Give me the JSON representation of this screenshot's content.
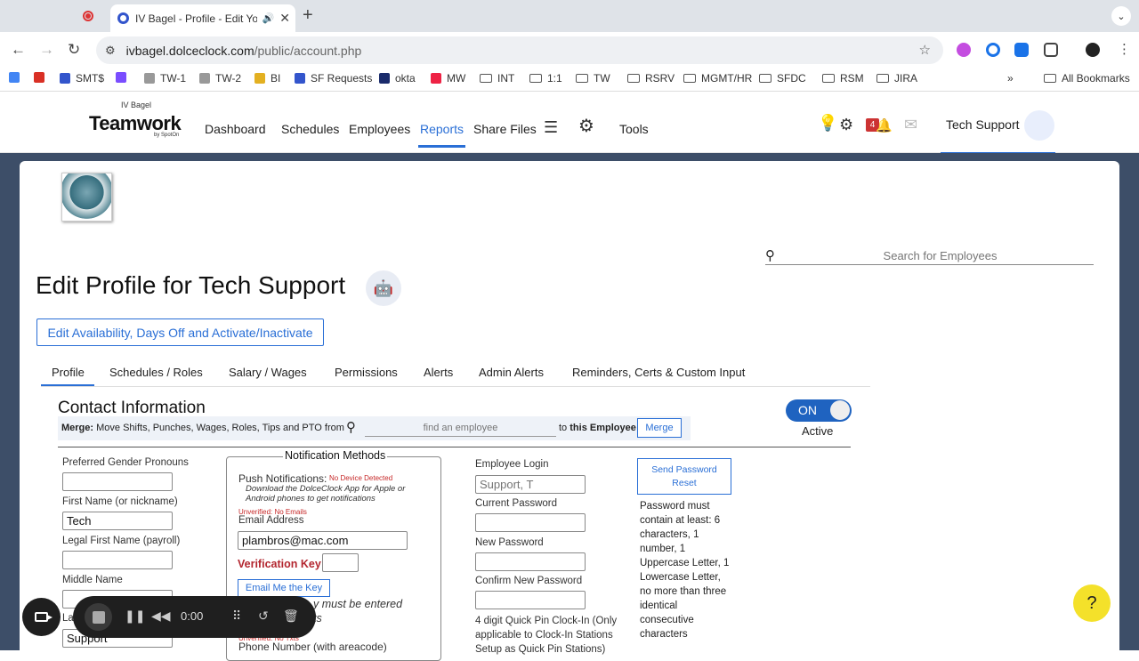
{
  "browser": {
    "tab_title": "IV Bagel - Profile - Edit Yo",
    "new_tab": "+",
    "tab_menu": "⌄",
    "url_host": "ivbagel.dolceclock.com",
    "url_path": "/public/account.php"
  },
  "bookmarks": [
    {
      "label": "",
      "icon": "calendar-icon",
      "color": "#4285f4"
    },
    {
      "label": "",
      "icon": "gmail-icon",
      "color": "#d93025"
    },
    {
      "label": "SMT$",
      "icon": "o-icon",
      "color": "#3355cc"
    },
    {
      "label": "",
      "icon": "s-icon",
      "color": "#7a4dff"
    },
    {
      "label": "TW-1",
      "icon": "mail-icon",
      "color": "#999"
    },
    {
      "label": "TW-2",
      "icon": "mail-icon",
      "color": "#999"
    },
    {
      "label": "BI",
      "icon": "chart-icon",
      "color": "#e3b021"
    },
    {
      "label": "SF Requests",
      "icon": "o-icon",
      "color": "#3355cc"
    },
    {
      "label": "okta",
      "icon": "okta-icon",
      "color": "#1a2b6b"
    },
    {
      "label": "MW",
      "icon": "mw-icon",
      "color": "#e24"
    },
    {
      "label": "INT",
      "icon": "folder-icon"
    },
    {
      "label": "1:1",
      "icon": "folder-icon"
    },
    {
      "label": "TW",
      "icon": "folder-icon"
    },
    {
      "label": "RSRV",
      "icon": "folder-icon"
    },
    {
      "label": "MGMT/HR",
      "icon": "folder-icon"
    },
    {
      "label": "SFDC",
      "icon": "folder-icon"
    },
    {
      "label": "RSM",
      "icon": "folder-icon"
    },
    {
      "label": "JIRA",
      "icon": "folder-icon"
    }
  ],
  "all_bookmarks": "All Bookmarks",
  "more_bookmarks": "»",
  "app": {
    "business": "IV Bagel",
    "logo": "Teamwork",
    "logo_sub": "by SpotOn",
    "nav": [
      "Dashboard",
      "Schedules",
      "Employees",
      "Reports",
      "Share Files",
      "Tools"
    ],
    "notif_count": "4",
    "user": "Tech Support"
  },
  "search": {
    "placeholder": "Search for Employees"
  },
  "page": {
    "title": "Edit Profile for Tech Support",
    "avail_button": "Edit Availability, Days Off and Activate/Inactivate",
    "tabs": [
      "Profile",
      "Schedules / Roles",
      "Salary / Wages",
      "Permissions",
      "Alerts",
      "Admin Alerts",
      "Reminders, Certs & Custom Input"
    ],
    "active_tab": "Profile"
  },
  "contact": {
    "heading": "Contact Information",
    "merge_label": "Merge:",
    "merge_text": "Move Shifts, Punches, Wages, Roles, Tips and PTO from",
    "merge_placeholder": "find an employee",
    "merge_to": "to",
    "merge_target": "this Employee",
    "merge_button": "Merge",
    "toggle": "ON",
    "status": "Active"
  },
  "fields": {
    "pronouns_label": "Preferred Gender Pronouns",
    "pronouns_value": "",
    "first_label": "First Name (or nickname)",
    "first_value": "Tech",
    "legal_first_label": "Legal First Name (payroll)",
    "legal_first_value": "",
    "middle_label": "Middle Name",
    "middle_value": "",
    "last_label": "La",
    "last_value": "Support"
  },
  "notif": {
    "title": "Notification Methods",
    "push_label": "Push Notifications:",
    "push_status": "No Device Detected",
    "push_hint": "Download the DolceClock App for Apple or Android phones to get notifications",
    "email_unverified": "Unverified: No Emails",
    "email_label": "Email Address",
    "email_value": "plambros@mac.com",
    "vkey_label": "Verification Key",
    "vkey_value": "",
    "email_key_button": "Email Me the Key",
    "hidden_note1": "y must be entered",
    "hidden_note2": "ts",
    "phone_unverified": "Unverified: No Txts",
    "phone_label": "Phone Number (with areacode)"
  },
  "login": {
    "login_label": "Employee Login",
    "login_placeholder": "Support, T",
    "current_label": "Current Password",
    "new_label": "New Password",
    "confirm_label": "Confirm New Password",
    "quickpin_text": "4 digit Quick Pin Clock-In (Only applicable to Clock-In Stations Setup as Quick Pin Stations)",
    "reset_button": "Send Password Reset",
    "pw_rules": "Password must contain at least: 6 characters, 1 number, 1 Uppercase Letter, 1 Lowercase Letter, no more than three identical consecutive characters"
  },
  "help": "?",
  "recorder": {
    "time": "0:00"
  }
}
